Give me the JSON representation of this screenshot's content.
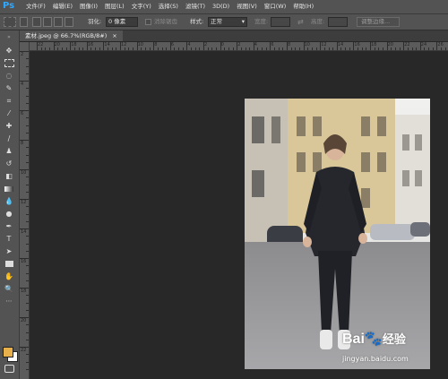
{
  "app": {
    "logo": "Ps",
    "menus": [
      "文件(F)",
      "编辑(E)",
      "图像(I)",
      "图层(L)",
      "文字(Y)",
      "选择(S)",
      "滤镜(T)",
      "3D(D)",
      "视图(V)",
      "窗口(W)",
      "帮助(H)"
    ]
  },
  "options": {
    "feather_label": "羽化:",
    "feather_value": "0 像素",
    "antialias_label": "消除锯齿",
    "style_label": "样式:",
    "style_value": "正常",
    "width_label": "宽度:",
    "height_label": "高度:",
    "refine_edge_button": "调整边缘..."
  },
  "document": {
    "tab_title": "素材.jpeg @ 66.7%(RGB/8#)",
    "close": "×"
  },
  "ruler": {
    "top_labels": [
      "22",
      "20",
      "18",
      "16",
      "14",
      "12",
      "10",
      "8",
      "6",
      "4",
      "2",
      "0",
      "2",
      "4",
      "6",
      "8",
      "10",
      "12",
      "14",
      "16",
      "18",
      "20",
      "22",
      "24",
      "26"
    ],
    "left_labels": [
      "2",
      "4",
      "6",
      "8",
      "10",
      "12",
      "14",
      "16",
      "18",
      "20",
      "22"
    ]
  },
  "watermark": {
    "brand": "Bai",
    "brand_suffix": "经验",
    "url": "jingyan.baidu.com"
  },
  "colors": {
    "foreground": "#e8b04a",
    "background": "#ffffff",
    "accent": "#31a8ff"
  }
}
